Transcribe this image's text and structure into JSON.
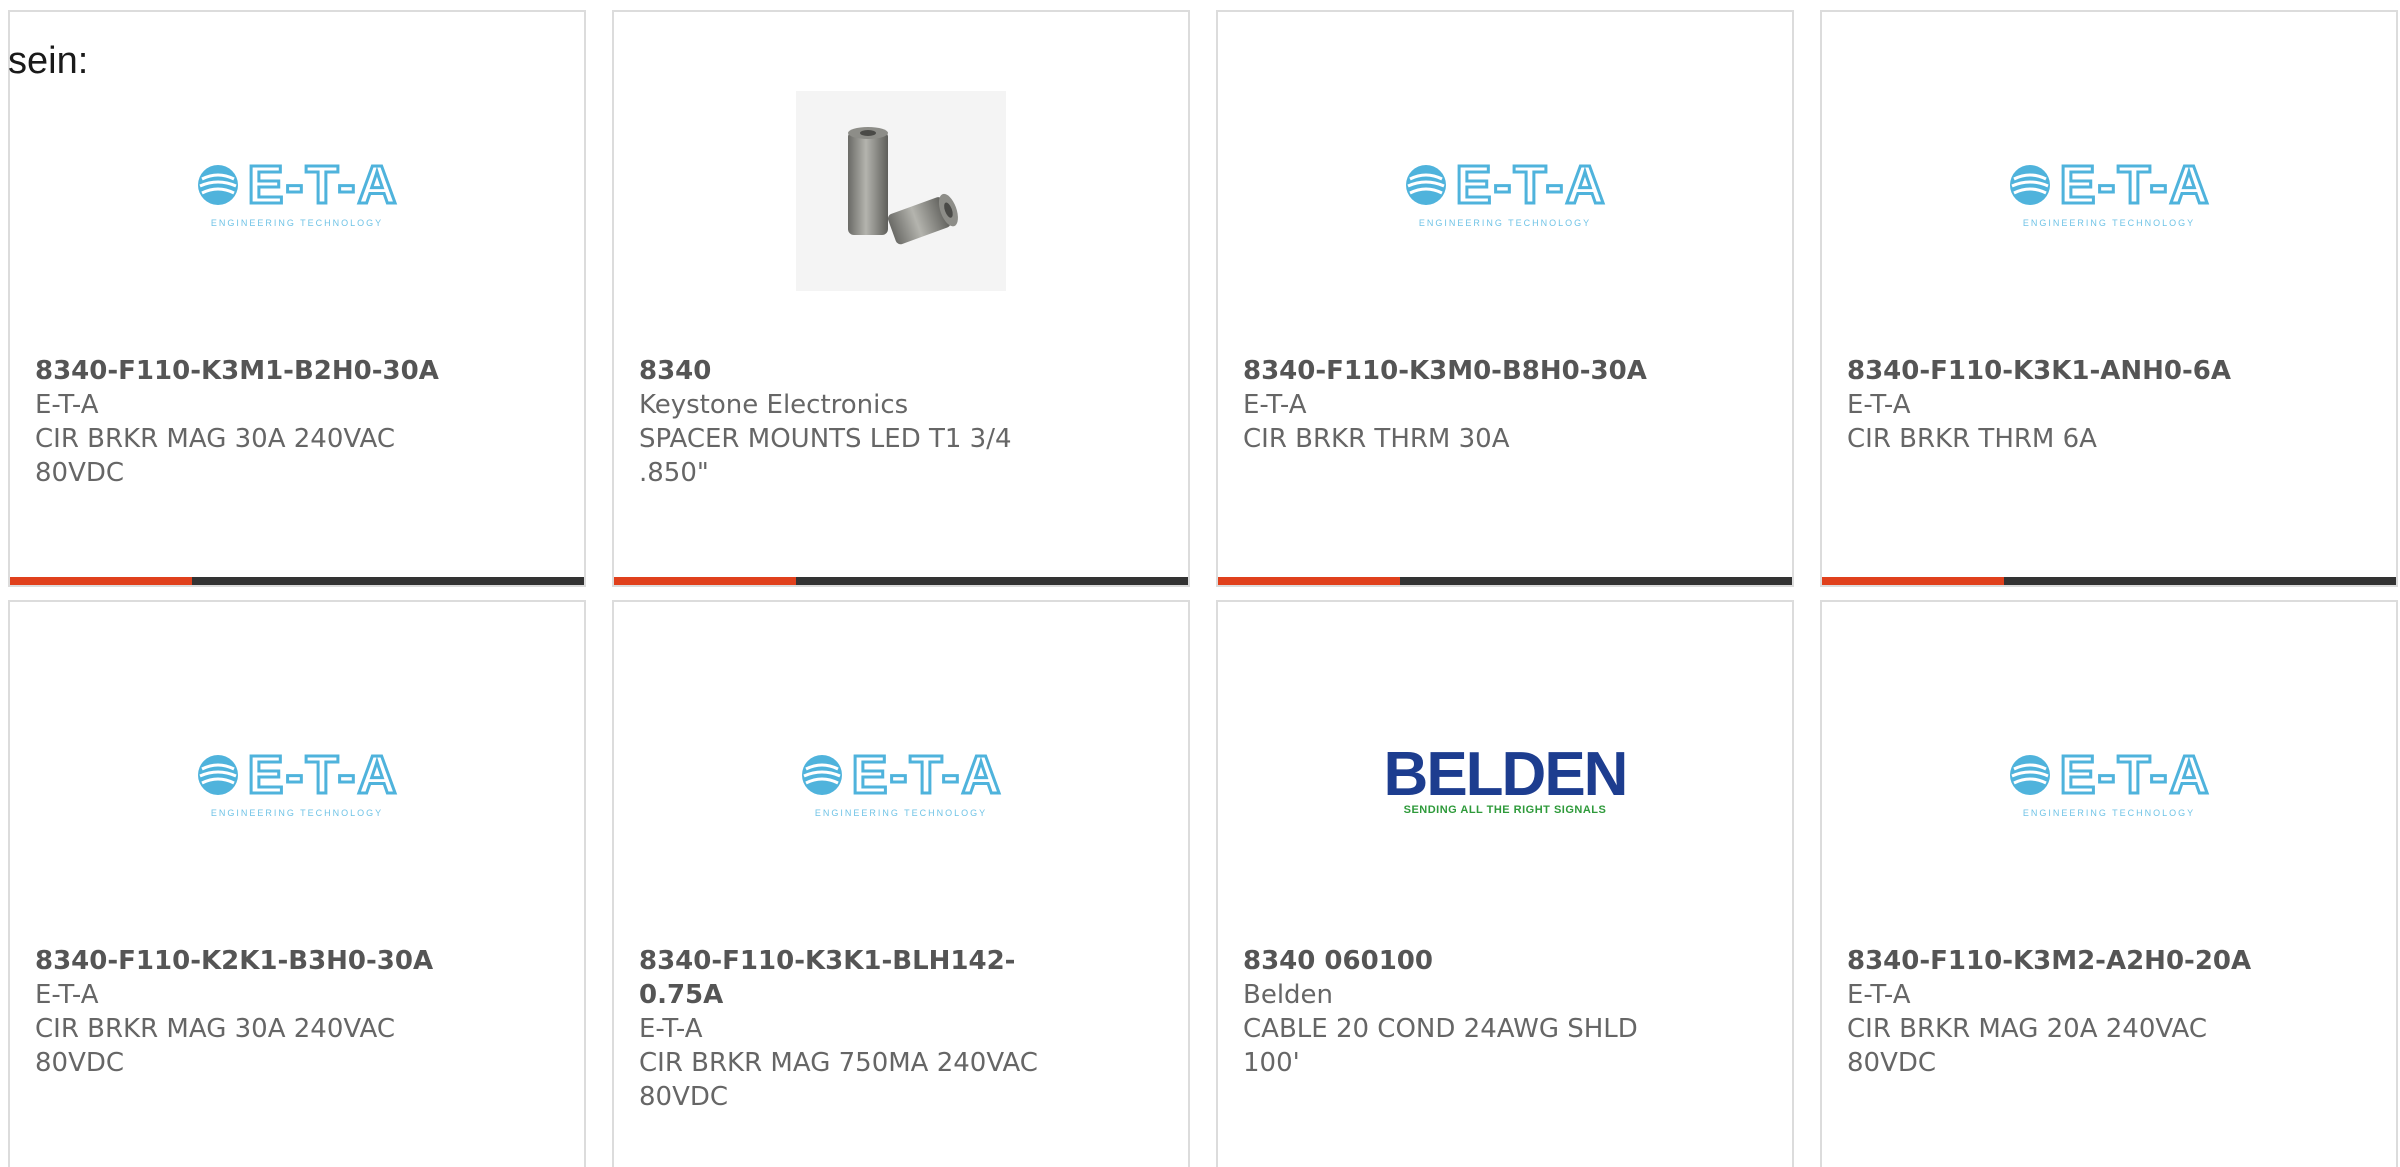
{
  "intro_text": "sein:",
  "colors": {
    "accent": "#e0401c",
    "bar": "#333333",
    "border": "#dcdcdc",
    "eta_blue": "#4fb3dc",
    "belden_blue": "#1d3d8f",
    "belden_green": "#2e9a3a"
  },
  "logos": {
    "eta": {
      "word": "E-T-A",
      "sub": "ENGINEERING TECHNOLOGY",
      "icon": "eta-globe-icon"
    },
    "belden": {
      "word": "BELDEN",
      "sub": "SENDING ALL THE RIGHT SIGNALS"
    }
  },
  "products": [
    {
      "part": "8340-F110-K3M1-B2H0-30A",
      "manufacturer": "E-T-A",
      "desc": "CIR BRKR MAG 30A 240VAC",
      "desc2": "80VDC",
      "image": "eta-logo"
    },
    {
      "part": "8340",
      "manufacturer": "Keystone Electronics",
      "desc": "SPACER MOUNTS LED T1 3/4",
      "desc2": ".850\"",
      "image": "spacer-photo"
    },
    {
      "part": "8340-F110-K3M0-B8H0-30A",
      "manufacturer": "E-T-A",
      "desc": "CIR BRKR THRM 30A",
      "desc2": "",
      "image": "eta-logo"
    },
    {
      "part": "8340-F110-K3K1-ANH0-6A",
      "manufacturer": "E-T-A",
      "desc": "CIR BRKR THRM 6A",
      "desc2": "",
      "image": "eta-logo"
    },
    {
      "part": "8340-F110-K2K1-B3H0-30A",
      "manufacturer": "E-T-A",
      "desc": "CIR BRKR MAG 30A 240VAC",
      "desc2": "80VDC",
      "image": "eta-logo"
    },
    {
      "part": "8340-F110-K3K1-BLH142-0.75A",
      "manufacturer": "E-T-A",
      "desc": "CIR BRKR MAG 750MA 240VAC",
      "desc2": "80VDC",
      "image": "eta-logo"
    },
    {
      "part": "8340 060100",
      "manufacturer": "Belden",
      "desc": "CABLE 20 COND 24AWG SHLD",
      "desc2": "100'",
      "image": "belden-logo"
    },
    {
      "part": "8340-F110-K3M2-A2H0-20A",
      "manufacturer": "E-T-A",
      "desc": "CIR BRKR MAG 20A 240VAC",
      "desc2": "80VDC",
      "image": "eta-logo"
    }
  ]
}
